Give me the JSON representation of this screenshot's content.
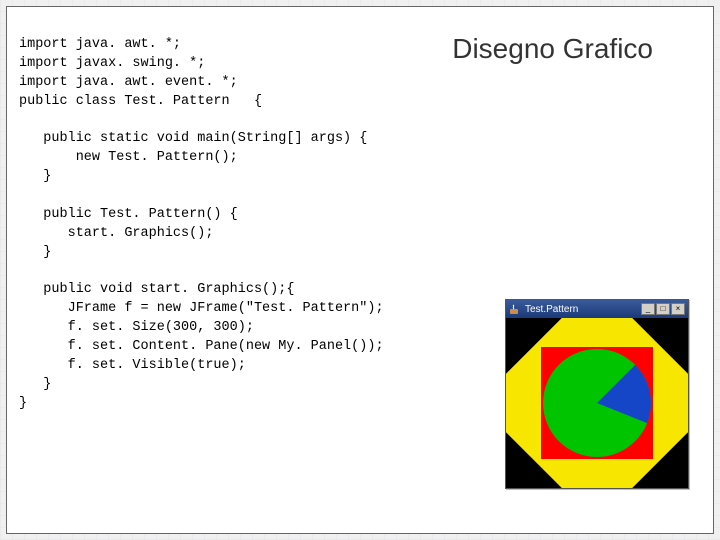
{
  "title": "Disegno Grafico",
  "code": {
    "l1": "import java. awt. *;",
    "l2": "import javax. swing. *;",
    "l3": "import java. awt. event. *;",
    "l4": "public class Test. Pattern   {",
    "l5": "   public static void main(String[] args) {",
    "l6": "       new Test. Pattern();",
    "l7": "   }",
    "l8": "   public Test. Pattern() {",
    "l9": "      start. Graphics();",
    "l10": "   }",
    "l11": "   public void start. Graphics();{",
    "l12": "      JFrame f = new JFrame(\"Test. Pattern\");",
    "l13": "      f. set. Size(300, 300);",
    "l14": "      f. set. Content. Pane(new My. Panel());",
    "l15": "      f. set. Visible(true);",
    "l16": "   }",
    "l17": "}"
  },
  "window": {
    "title": "Test.Pattern",
    "btn_min": "_",
    "btn_max": "□",
    "btn_close": "×"
  },
  "colors": {
    "diamond": "#f7e600",
    "square": "#ff0000",
    "circle": "#00c400",
    "wedge": "#1646c8"
  }
}
